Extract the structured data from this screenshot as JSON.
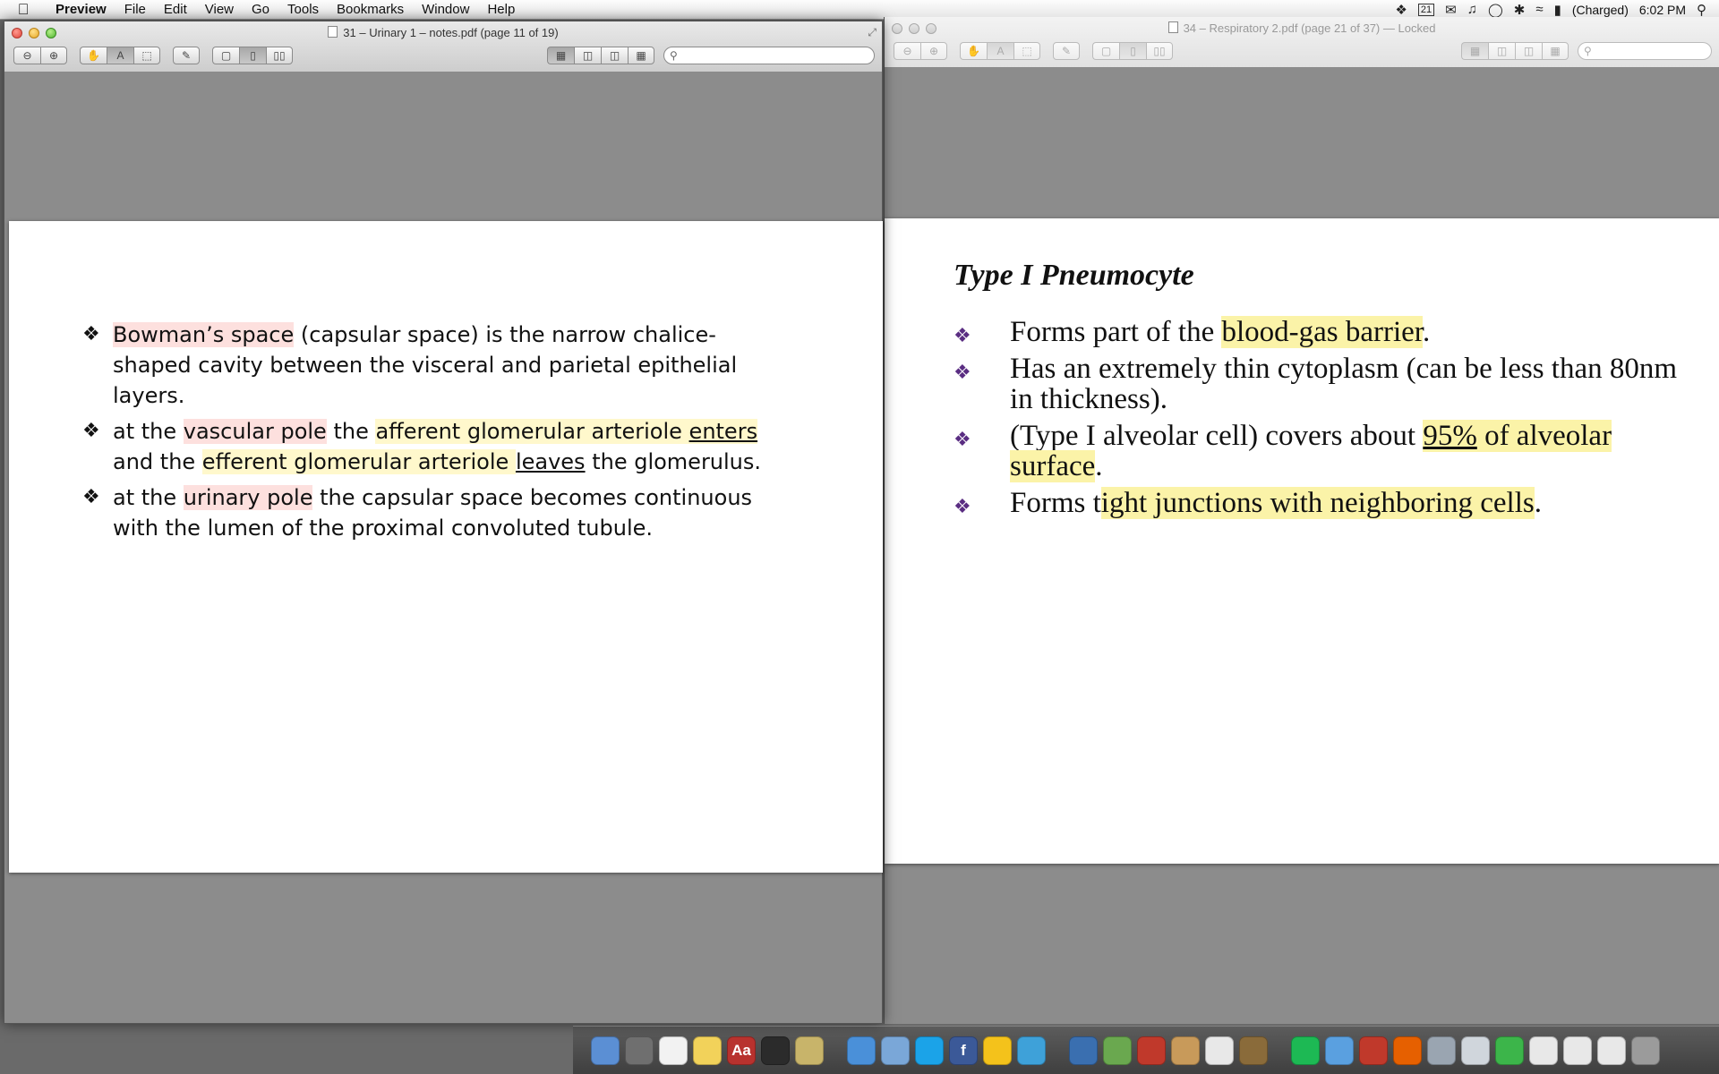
{
  "menubar": {
    "apple": "",
    "items": [
      "Preview",
      "File",
      "Edit",
      "View",
      "Go",
      "Tools",
      "Bookmarks",
      "Window",
      "Help"
    ],
    "status": {
      "calendar_day": "21",
      "battery": "(Charged)",
      "time": "6:02 PM"
    }
  },
  "left_window": {
    "title": "31 – Urinary 1 – notes.pdf (page 11 of 19)",
    "bullets": [
      [
        {
          "t": "Bowman’s space",
          "h": "pink"
        },
        {
          "t": " (capsular space) is the narrow chalice-shaped cavity between the visceral and parietal epithelial layers."
        }
      ],
      [
        {
          "t": "at the "
        },
        {
          "t": "vascular pole",
          "h": "pink"
        },
        {
          "t": " the "
        },
        {
          "t": "afferent glomerular arteriole ",
          "h": "yel"
        },
        {
          "t": "enters",
          "h": "yel",
          "u": true
        },
        {
          "t": " and the "
        },
        {
          "t": "efferent glomerular arteriole ",
          "h": "yel"
        },
        {
          "t": "leaves",
          "u": true
        },
        {
          "t": " the glomerulus."
        }
      ],
      [
        {
          "t": "at the "
        },
        {
          "t": "urinary pole",
          "h": "pink"
        },
        {
          "t": " the capsular space becomes continuous with the lumen of the proximal convoluted tubule."
        }
      ]
    ]
  },
  "right_window": {
    "title": "34 – Respiratory 2.pdf (page 21 of 37)",
    "locked": "— Locked",
    "heading": "Type I Pneumocyte",
    "bullets": [
      [
        {
          "t": "Forms part of the "
        },
        {
          "t": "blood-gas barrier",
          "h": "y2"
        },
        {
          "t": "."
        }
      ],
      [
        {
          "t": "Has an extremely thin cytoplasm (can be less than 80nm in thickness)."
        }
      ],
      [
        {
          "t": "(Type I alveolar cell) covers about "
        },
        {
          "t": "95%",
          "h": "y2",
          "u": true
        },
        {
          "t": " of alveolar surface",
          "h": "y2"
        },
        {
          "t": "."
        }
      ],
      [
        {
          "t": "Forms t"
        },
        {
          "t": "ight junctions with neighboring cells",
          "h": "y2"
        },
        {
          "t": "."
        }
      ]
    ]
  },
  "dock": {
    "icons": [
      "finder-icon",
      "launchpad-icon",
      "reminders-icon",
      "stickies-icon",
      "dictionary-icon",
      "terminal-icon",
      "preview-icon",
      "safari-icon",
      "mail-icon",
      "skype-icon",
      "facebook-icon",
      "app-icon",
      "twitter-icon",
      "app-store-icon",
      "app-icon",
      "calculator-icon",
      "package-icon",
      "text-icon",
      "app-icon",
      "spotify-icon",
      "itunes-icon",
      "app-icon",
      "firefox-icon",
      "app-icon",
      "documents-icon",
      "downloads-icon",
      "app-icon",
      "app-icon",
      "app-icon",
      "trash-icon"
    ],
    "labels": {
      "dictionary": "Aa",
      "facebook": "f"
    }
  },
  "colors": {
    "highlight_pink": "#fde0de",
    "highlight_yellow": "#fff8cc",
    "highlight_yellow2": "#fbf3a8",
    "bullet_purple": "#5a2d82"
  }
}
